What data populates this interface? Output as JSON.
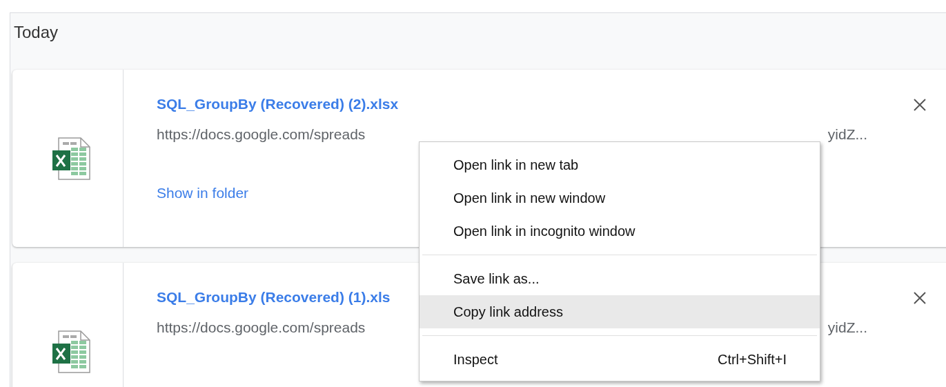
{
  "section": {
    "title": "Today"
  },
  "downloads": [
    {
      "name": "SQL_GroupBy (Recovered) (2).xlsx",
      "url_start": "https://docs.google.com/spreads",
      "url_end": "yidZ...",
      "action": "Show in folder"
    },
    {
      "name": "SQL_GroupBy (Recovered) (1).xls",
      "url_start": "https://docs.google.com/spreads",
      "url_end": "yidZ..."
    }
  ],
  "context_menu": {
    "groups": [
      [
        {
          "label": "Open link in new tab",
          "selected": false
        },
        {
          "label": "Open link in new window",
          "selected": false
        },
        {
          "label": "Open link in incognito window",
          "selected": false
        }
      ],
      [
        {
          "label": "Save link as...",
          "selected": false
        },
        {
          "label": "Copy link address",
          "selected": true
        }
      ],
      [
        {
          "label": "Inspect",
          "shortcut": "Ctrl+Shift+I",
          "selected": false
        }
      ]
    ]
  }
}
